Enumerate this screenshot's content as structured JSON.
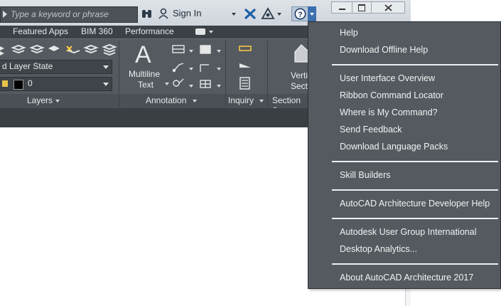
{
  "titlebar": {
    "search_placeholder": "Type a keyword or phrase",
    "signin_label": "Sign In",
    "icons": [
      "binoculars-icon",
      "user-icon",
      "exchange-x-icon",
      "autodesk-a360-icon",
      "help-question-icon"
    ]
  },
  "window_controls": [
    "minimize",
    "restore",
    "close"
  ],
  "tabs": [
    "Featured Apps",
    "BIM 360",
    "Performance"
  ],
  "ribbon": {
    "layer_state": "d Layer State",
    "layer_name": "0",
    "panels": {
      "layers": "Layers",
      "annotation": "Annotation",
      "inquiry": "Inquiry",
      "section": "Section &"
    },
    "multiline_text": [
      "Multiline",
      "Text"
    ],
    "vertical_section": [
      "Verti",
      "Secti"
    ]
  },
  "help_menu": {
    "items": [
      "Help",
      "Download Offline Help",
      "User Interface Overview",
      "Ribbon Command Locator",
      "Where is My Command?",
      "Send Feedback",
      "Download Language Packs",
      "Skill Builders",
      "AutoCAD Architecture Developer Help",
      "Autodesk User Group International",
      "Desktop Analytics...",
      "About AutoCAD Architecture 2017"
    ]
  },
  "colors": {
    "ribbon_bg": "#545a60",
    "menu_bg": "#545a60",
    "titlebar_bg": "#d8dde2",
    "text_light": "#f2f2f2",
    "autodesk_blue": "#1b5fa8"
  }
}
